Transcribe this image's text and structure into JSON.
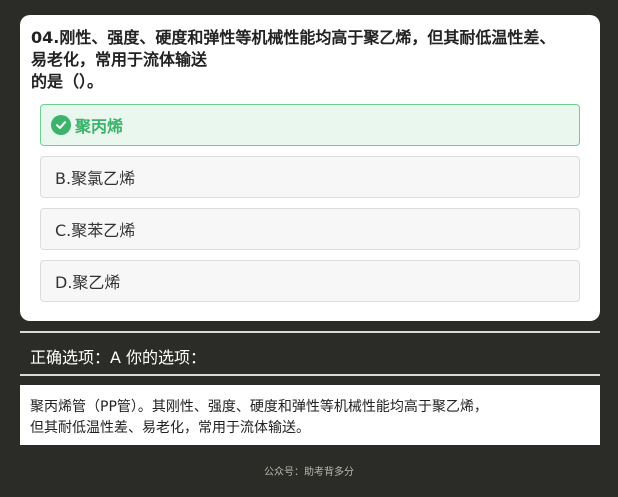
{
  "question": {
    "line1": "04.刚性、强度、硬度和弹性等机械性能均高于聚乙烯，但其耐低温性差、",
    "line2": "易老化，常用于流体输送",
    "line3": "的是（）。"
  },
  "options": [
    {
      "label": "聚丙烯",
      "correct": true
    },
    {
      "label": "B.聚氯乙烯",
      "correct": false
    },
    {
      "label": "C.聚苯乙烯",
      "correct": false
    },
    {
      "label": "D.聚乙烯",
      "correct": false
    }
  ],
  "answer": {
    "text": "正确选项：A 你的选项："
  },
  "explanation": {
    "line1": "聚丙烯管（PP管）。其刚性、强度、硬度和弹性等机械性能均高于聚乙烯，",
    "line2": "但其耐低温性差、易老化，常用于流体输送。"
  },
  "footer": {
    "text": "公众号：助考背多分"
  },
  "colors": {
    "background": "#2b2b27",
    "correct_green": "#3bb36a",
    "correct_bg": "#e9f7ee"
  },
  "icons": {
    "correct": "check-circle-icon"
  }
}
